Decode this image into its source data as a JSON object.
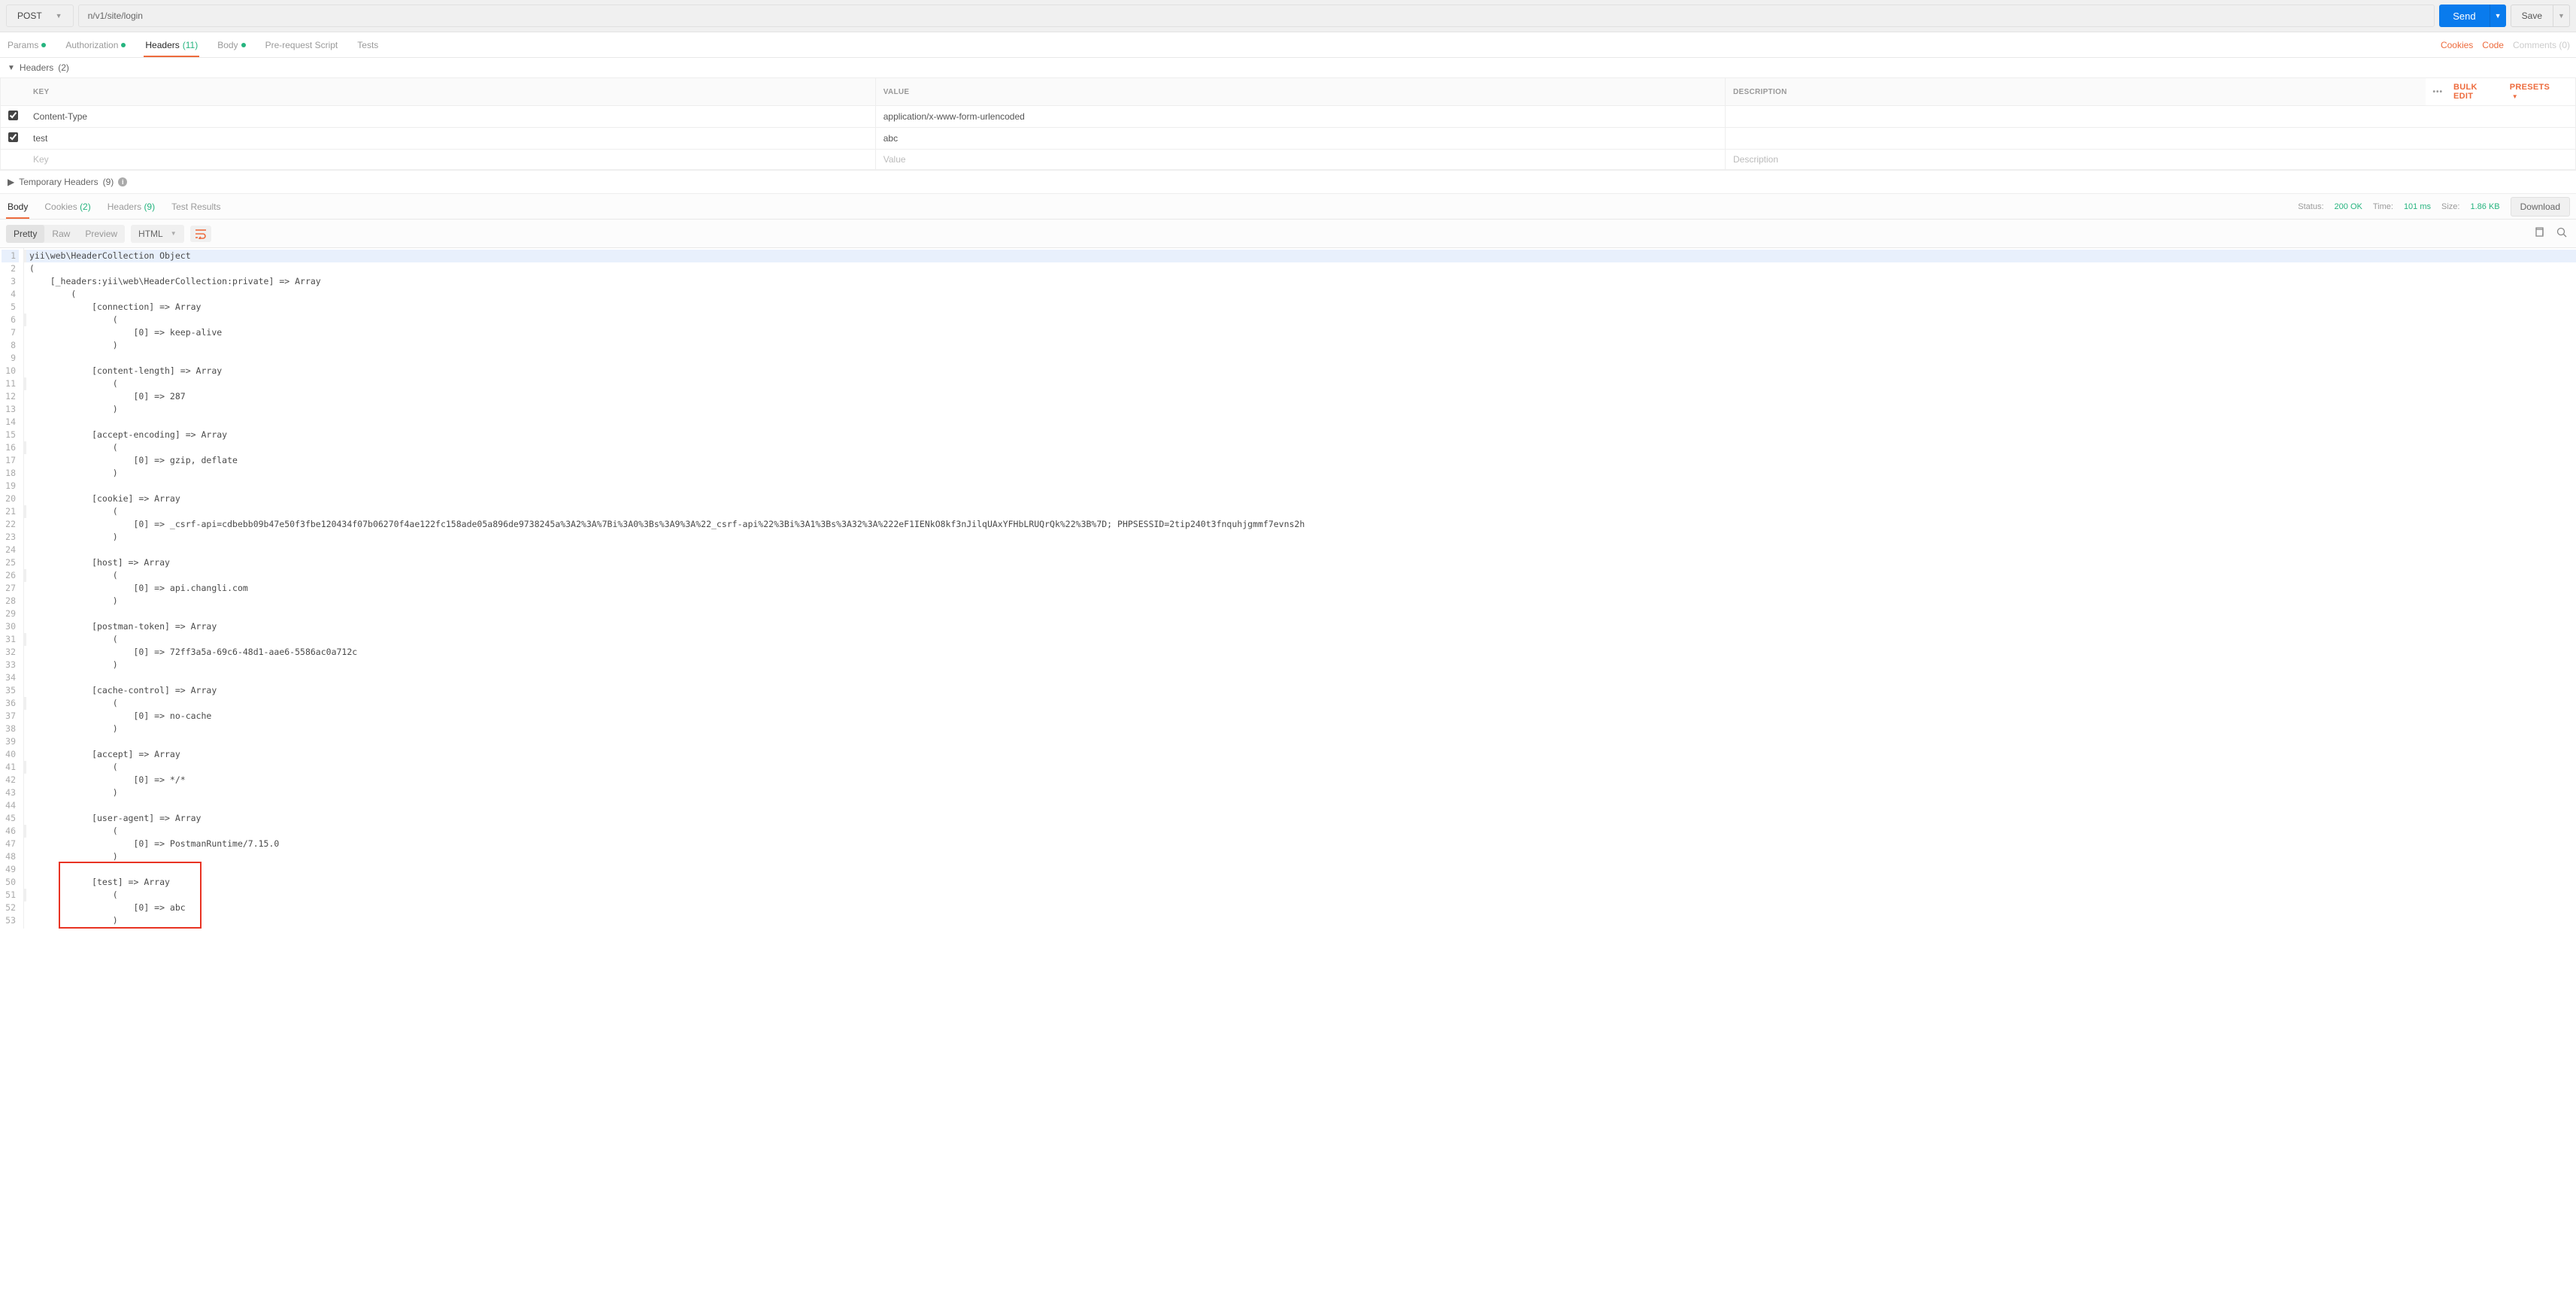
{
  "request": {
    "method": "POST",
    "url_blur": "                    ",
    "url": "n/v1/site/login",
    "send_label": "Send",
    "save_label": "Save"
  },
  "req_tabs": {
    "params": "Params",
    "auth": "Authorization",
    "headers_label": "Headers",
    "headers_count": "(11)",
    "body": "Body",
    "prereq": "Pre-request Script",
    "tests": "Tests"
  },
  "req_actions": {
    "cookies": "Cookies",
    "code": "Code",
    "comments": "Comments (0)"
  },
  "headers_section": {
    "title": "Headers",
    "count": "(2)"
  },
  "headers_table": {
    "cols": {
      "key": "KEY",
      "value": "VALUE",
      "desc": "DESCRIPTION"
    },
    "rows": [
      {
        "checked": true,
        "key": "Content-Type",
        "value": "application/x-www-form-urlencoded",
        "desc": ""
      },
      {
        "checked": true,
        "key": "test",
        "value": "abc",
        "desc": ""
      }
    ],
    "new_row": {
      "key_ph": "Key",
      "value_ph": "Value",
      "desc_ph": "Description"
    },
    "more": "•••",
    "bulk": "Bulk Edit",
    "presets": "Presets"
  },
  "temp_headers": {
    "label": "Temporary Headers",
    "count": "(9)"
  },
  "resp_tabs": {
    "body": "Body",
    "cookies_label": "Cookies",
    "cookies_count": "(2)",
    "headers_label": "Headers",
    "headers_count": "(9)",
    "tests": "Test Results"
  },
  "resp_meta": {
    "status_label": "Status:",
    "status_val": "200 OK",
    "time_label": "Time:",
    "time_val": "101 ms",
    "size_label": "Size:",
    "size_val": "1.86 KB",
    "download": "Download"
  },
  "body_toolbar": {
    "pretty": "Pretty",
    "raw": "Raw",
    "preview": "Preview",
    "lang": "HTML"
  },
  "code": [
    "yii\\web\\HeaderCollection Object",
    "(",
    "    [_headers:yii\\web\\HeaderCollection:private] => Array",
    "        (",
    "            [connection] => Array",
    "                (",
    "                    [0] => keep-alive",
    "                )",
    "",
    "            [content-length] => Array",
    "                (",
    "                    [0] => 287",
    "                )",
    "",
    "            [accept-encoding] => Array",
    "                (",
    "                    [0] => gzip, deflate",
    "                )",
    "",
    "            [cookie] => Array",
    "                (",
    "                    [0] => _csrf-api=cdbebb09b47e50f3fbe120434f07b06270f4ae122fc158ade05a896de9738245a%3A2%3A%7Bi%3A0%3Bs%3A9%3A%22_csrf-api%22%3Bi%3A1%3Bs%3A32%3A%222eF1IENkO8kf3nJilqUAxYFHbLRUQrQk%22%3B%7D; PHPSESSID=2tip240t3fnquhjgmmf7evns2h",
    "                )",
    "",
    "            [host] => Array",
    "                (",
    "                    [0] => api.changli.com",
    "                )",
    "",
    "            [postman-token] => Array",
    "                (",
    "                    [0] => 72ff3a5a-69c6-48d1-aae6-5586ac0a712c",
    "                )",
    "",
    "            [cache-control] => Array",
    "                (",
    "                    [0] => no-cache",
    "                )",
    "",
    "            [accept] => Array",
    "                (",
    "                    [0] => */*",
    "                )",
    "",
    "            [user-agent] => Array",
    "                (",
    "                    [0] => PostmanRuntime/7.15.0",
    "                )",
    "",
    "            [test] => Array",
    "                (",
    "                    [0] => abc",
    "                )"
  ]
}
